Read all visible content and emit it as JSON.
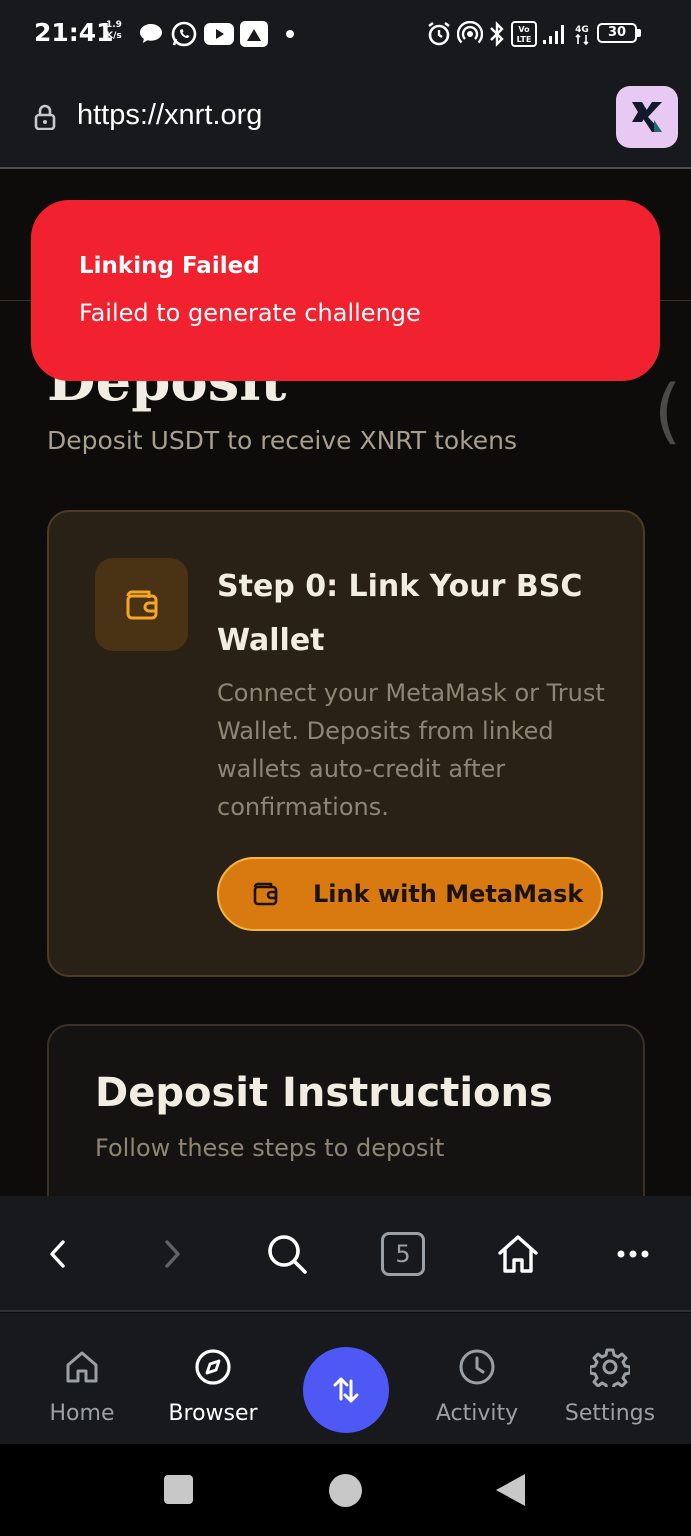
{
  "status_bar": {
    "time": "21:41",
    "net_speed_value": "1.9",
    "net_speed_unit": "K/s",
    "battery": "30"
  },
  "url_bar": {
    "url": "https://xnrt.org"
  },
  "toast": {
    "title": "Linking Failed",
    "message": "Failed to generate challenge",
    "color": "#f2212f"
  },
  "page": {
    "title": "Deposit",
    "subtitle": "Deposit USDT to receive XNRT tokens",
    "step_card": {
      "title": "Step 0: Link Your BSC Wallet",
      "description": "Connect your MetaMask or Trust Wallet. Deposits from linked wallets auto-credit after confirmations.",
      "button_label": "Link with MetaMask",
      "accent_color": "#d97a10"
    },
    "instructions_card": {
      "title": "Deposit Instructions",
      "subtitle": "Follow these steps to deposit"
    }
  },
  "browser_toolbar": {
    "tab_count": "5"
  },
  "bottom_nav": {
    "items": [
      {
        "label": "Home",
        "icon": "home-icon"
      },
      {
        "label": "Browser",
        "icon": "compass-icon",
        "active": true
      },
      {
        "label": "Activity",
        "icon": "clock-icon"
      },
      {
        "label": "Settings",
        "icon": "gear-icon"
      }
    ],
    "fab_icon": "swap-arrows-icon",
    "fab_color": "#4d58f5"
  }
}
